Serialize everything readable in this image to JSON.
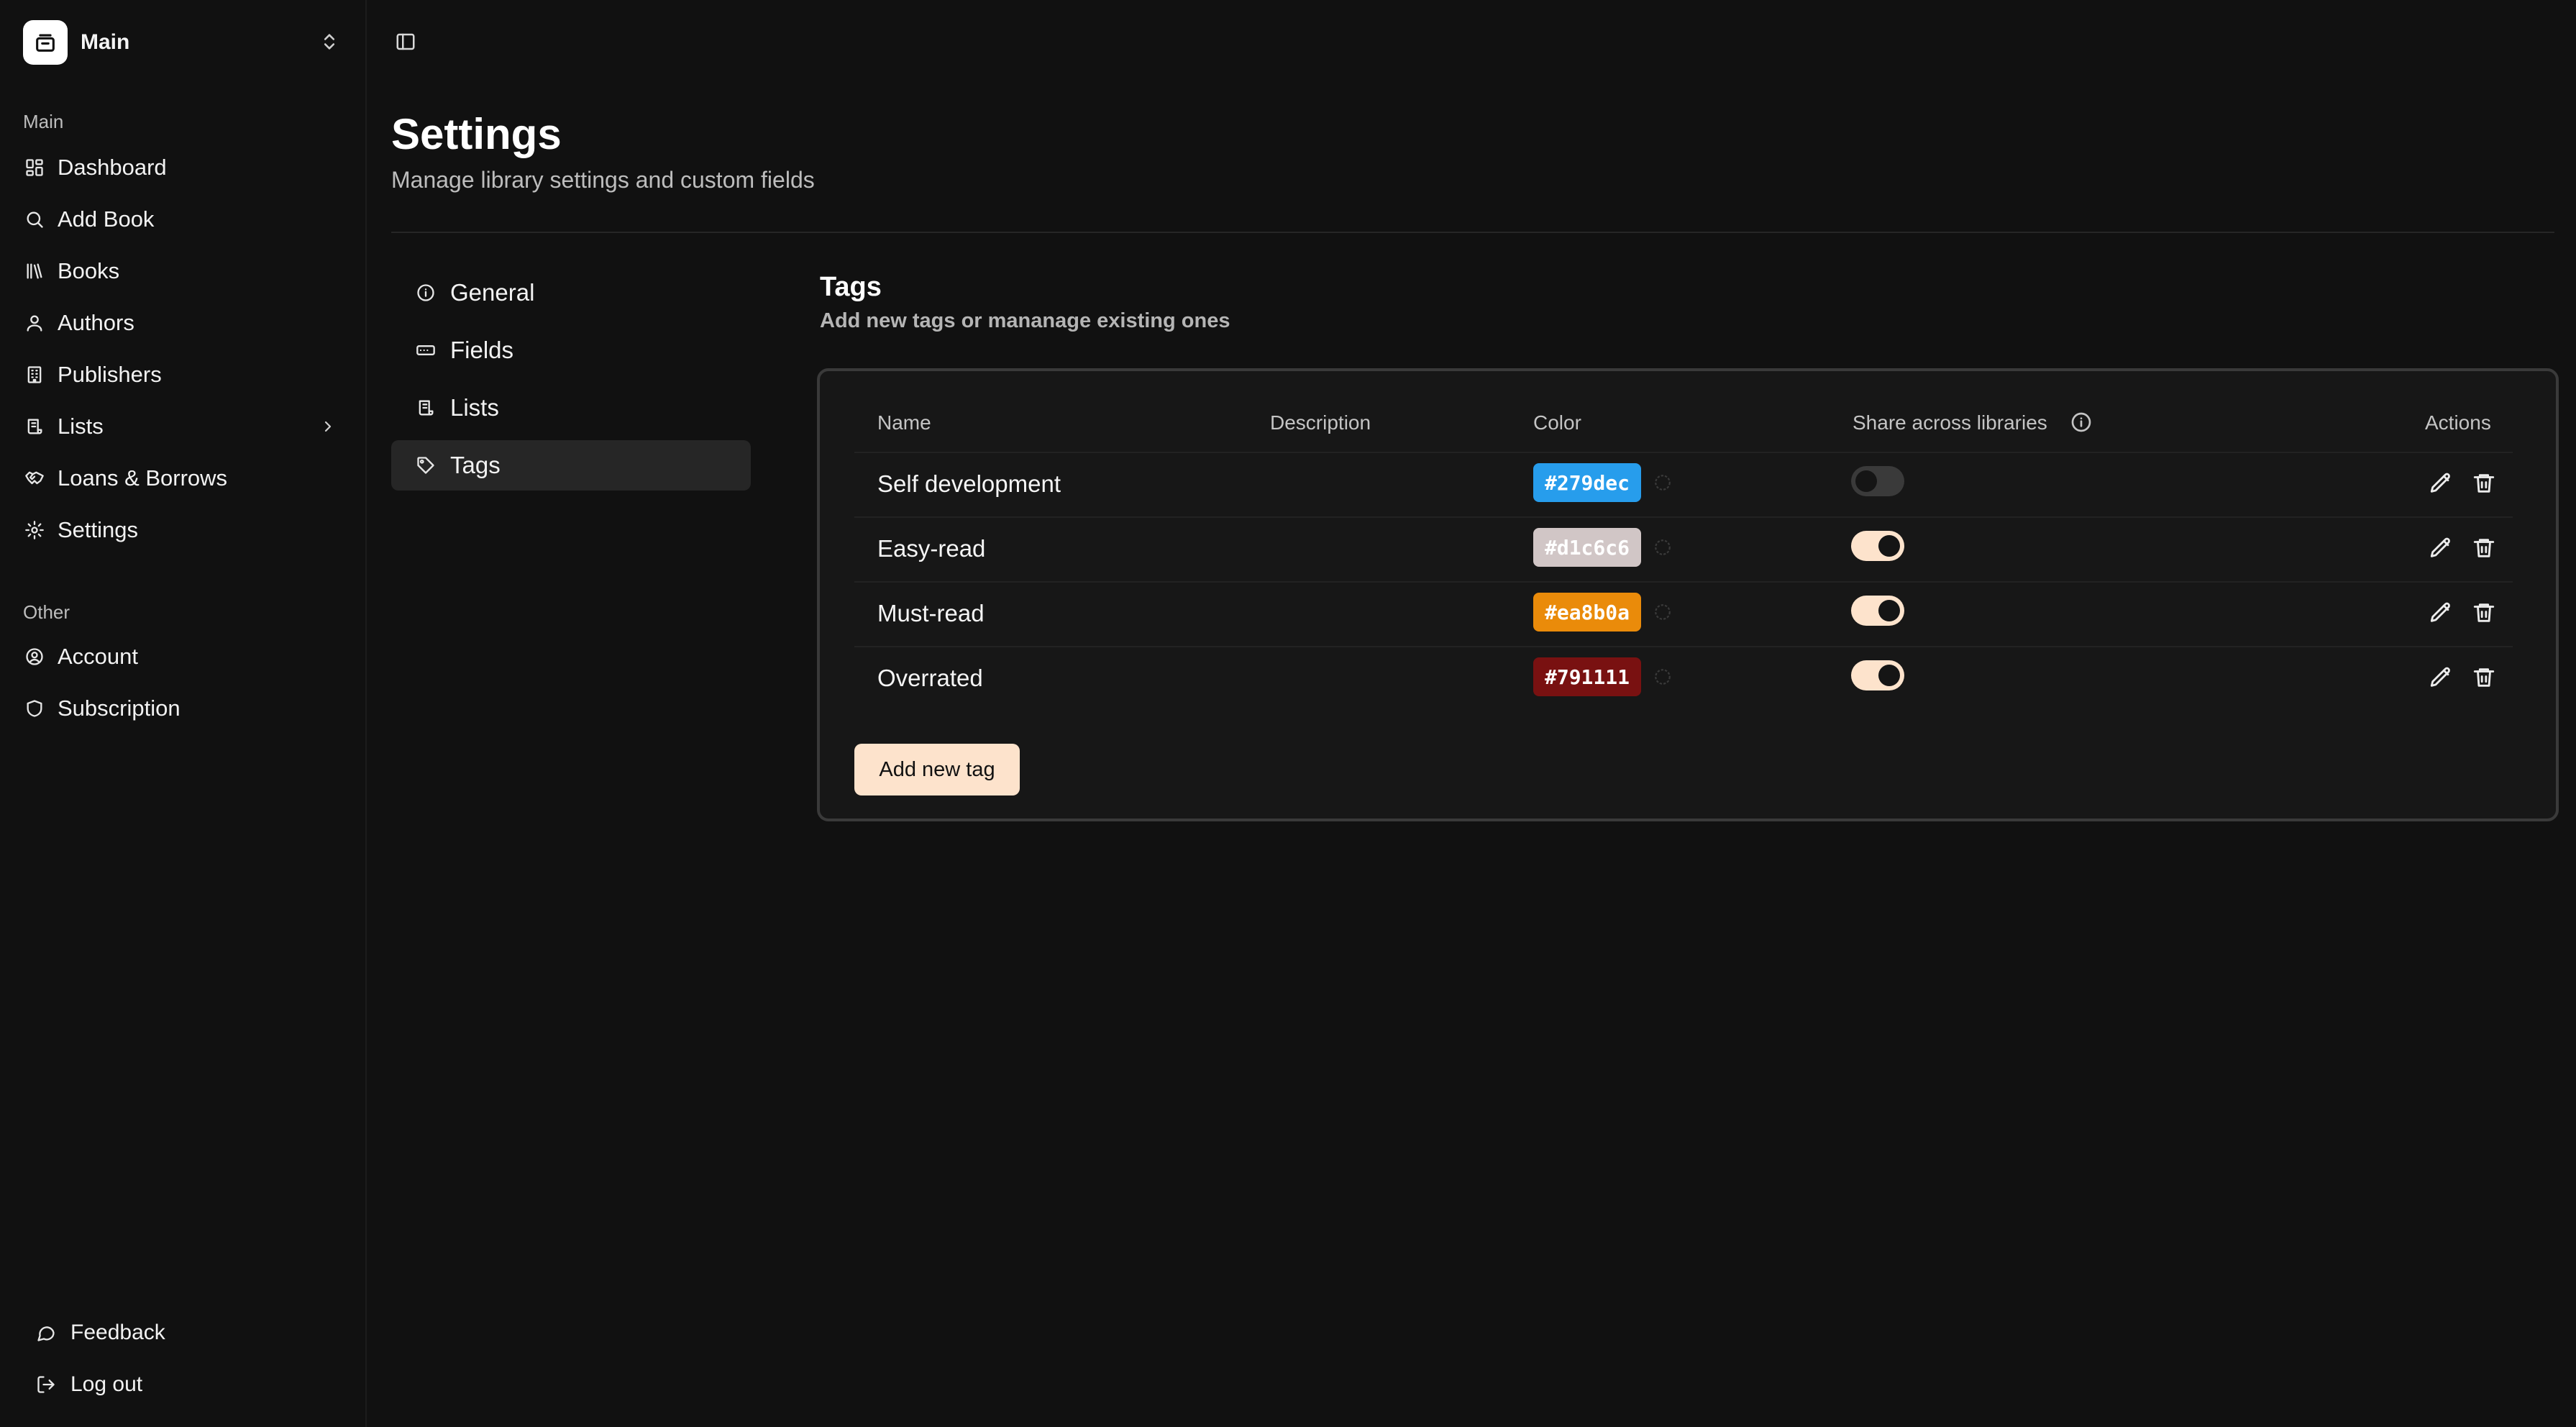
{
  "workspace": {
    "name": "Main"
  },
  "sidebar": {
    "main_label": "Main",
    "main_items": [
      {
        "label": "Dashboard",
        "icon": "dashboard-icon"
      },
      {
        "label": "Add Book",
        "icon": "search-icon"
      },
      {
        "label": "Books",
        "icon": "library-icon"
      },
      {
        "label": "Authors",
        "icon": "user-icon"
      },
      {
        "label": "Publishers",
        "icon": "building-icon"
      },
      {
        "label": "Lists",
        "icon": "scroll-icon"
      },
      {
        "label": "Loans & Borrows",
        "icon": "handshake-icon"
      },
      {
        "label": "Settings",
        "icon": "gear-icon"
      }
    ],
    "other_label": "Other",
    "other_items": [
      {
        "label": "Account",
        "icon": "user-circle-icon"
      },
      {
        "label": "Subscription",
        "icon": "shield-icon"
      }
    ],
    "bottom_items": [
      {
        "label": "Feedback",
        "icon": "message-icon"
      },
      {
        "label": "Log out",
        "icon": "logout-icon"
      }
    ]
  },
  "page": {
    "title": "Settings",
    "subtitle": "Manage library settings and custom fields"
  },
  "settings_nav": [
    {
      "label": "General",
      "icon": "info-icon",
      "active": false
    },
    {
      "label": "Fields",
      "icon": "input-icon",
      "active": false
    },
    {
      "label": "Lists",
      "icon": "scroll-icon",
      "active": false
    },
    {
      "label": "Tags",
      "icon": "tag-icon",
      "active": true
    }
  ],
  "tags_section": {
    "title": "Tags",
    "subtitle": "Add new tags or mananage existing ones",
    "columns": {
      "name": "Name",
      "description": "Description",
      "color": "Color",
      "share": "Share across libraries",
      "actions": "Actions"
    },
    "rows": [
      {
        "name": "Self development",
        "description": "",
        "color": "#279dec",
        "color_label": "#279dec",
        "shared": false
      },
      {
        "name": "Easy-read",
        "description": "",
        "color": "#d1c6c6",
        "color_label": "#d1c6c6",
        "shared": true
      },
      {
        "name": "Must-read",
        "description": "",
        "color": "#ea8b0a",
        "color_label": "#ea8b0a",
        "shared": true
      },
      {
        "name": "Overrated",
        "description": "",
        "color": "#791111",
        "color_label": "#791111",
        "shared": true
      }
    ],
    "add_button": "Add new tag"
  },
  "colors": {
    "background": "#111111",
    "accent": "#fde3cc",
    "active_nav": "#262626"
  }
}
